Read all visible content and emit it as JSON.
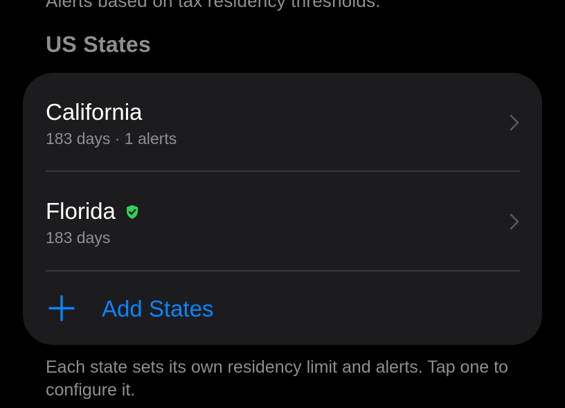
{
  "top_caption": "Alerts based on tax residency thresholds.",
  "section": {
    "title": "US States"
  },
  "states": [
    {
      "name": "California",
      "subtitle": "183 days · 1 alerts",
      "verified": false
    },
    {
      "name": "Florida",
      "subtitle": "183 days",
      "verified": true
    }
  ],
  "add_button": {
    "label": "Add States",
    "icon": "plus-icon"
  },
  "footer": {
    "text": "Each state sets its own residency limit and alerts. Tap one to configure it."
  },
  "colors": {
    "background": "#000000",
    "card": "#1c1c1e",
    "accent": "#0a84ff",
    "secondary_text": "#8e8e93",
    "verified": "#30d158",
    "divider": "#38383a"
  },
  "icons": {
    "row_chevron": "chevron-right-icon",
    "verified_badge": "shield-check-icon"
  }
}
